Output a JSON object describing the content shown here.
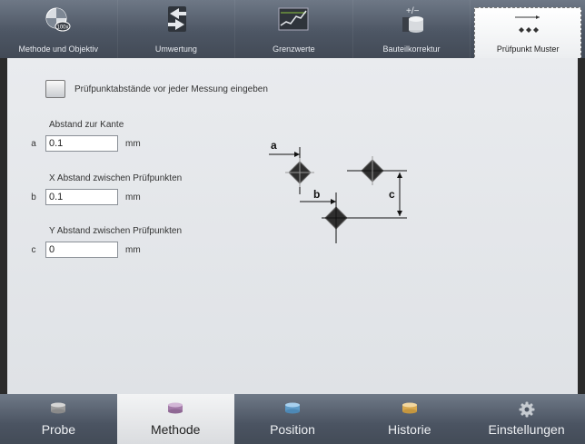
{
  "top_tabs": [
    {
      "label": "Methode und Objektiv",
      "icon": "objective-lens-icon"
    },
    {
      "label": "Umwertung",
      "icon": "conversion-arrows-icon"
    },
    {
      "label": "Grenzwerte",
      "icon": "limits-chart-icon"
    },
    {
      "label": "Bauteilkorrektur",
      "icon": "part-correction-icon"
    },
    {
      "label": "Prüfpunkt Muster",
      "icon": "point-pattern-icon"
    }
  ],
  "checkbox_label": "Prüfpunktabstände vor jeder Messung eingeben",
  "fields": [
    {
      "title": "Abstand zur Kante",
      "letter": "a",
      "value": "0.1",
      "unit": "mm"
    },
    {
      "title": "X Abstand zwischen Prüfpunkten",
      "letter": "b",
      "value": "0.1",
      "unit": "mm"
    },
    {
      "title": "Y Abstand zwischen Prüfpunkten",
      "letter": "c",
      "value": "0",
      "unit": "mm"
    }
  ],
  "diagram_labels": {
    "a": "a",
    "b": "b",
    "c": "c"
  },
  "bottom_tabs": [
    {
      "label": "Probe",
      "icon": "probe-cylinder-icon",
      "color": "#b8b8b8"
    },
    {
      "label": "Methode",
      "icon": "method-cylinder-icon",
      "color": "#b38fb8"
    },
    {
      "label": "Position",
      "icon": "position-cylinder-icon",
      "color": "#7fb2d8"
    },
    {
      "label": "Historie",
      "icon": "history-cylinder-icon",
      "color": "#e8c27a"
    },
    {
      "label": "Einstellungen",
      "icon": "settings-gear-icon",
      "color": "#bfc4ca"
    }
  ]
}
